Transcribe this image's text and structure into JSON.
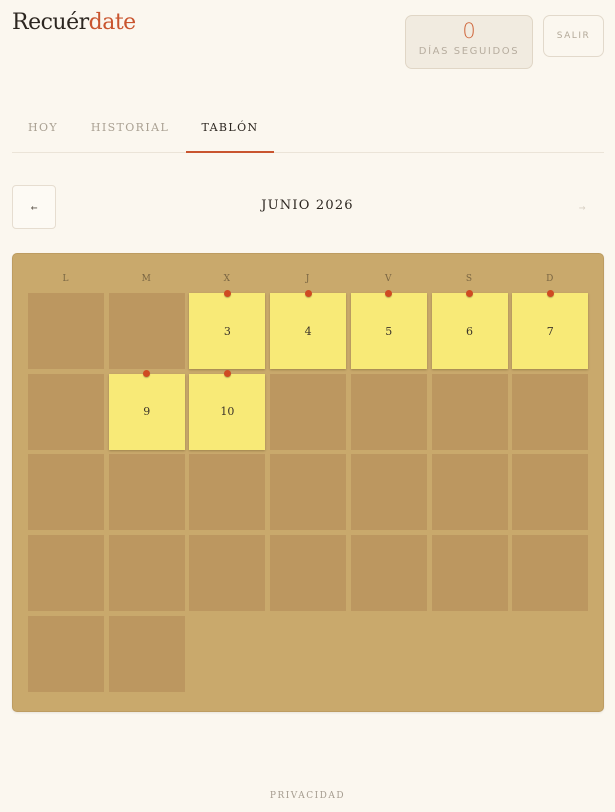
{
  "header": {
    "logo_main": "Recuér",
    "logo_accent": "date",
    "streak_count": "0",
    "streak_label": "DÍAS SEGUIDOS",
    "logout_label": "SALIR"
  },
  "tabs": [
    {
      "label": "HOY",
      "active": false
    },
    {
      "label": "HISTORIAL",
      "active": false
    },
    {
      "label": "TABLÓN",
      "active": true
    }
  ],
  "calendar": {
    "month_label": "JUNIO 2026",
    "prev_icon": "arrow-left-icon",
    "next_icon": "arrow-right-icon",
    "weekdays": [
      "L",
      "M",
      "X",
      "J",
      "V",
      "S",
      "D"
    ],
    "weeks": [
      [
        {
          "day": "",
          "note": false
        },
        {
          "day": "",
          "note": false
        },
        {
          "day": "3",
          "note": true
        },
        {
          "day": "4",
          "note": true
        },
        {
          "day": "5",
          "note": true
        },
        {
          "day": "6",
          "note": true
        },
        {
          "day": "7",
          "note": true
        }
      ],
      [
        {
          "day": "",
          "note": false
        },
        {
          "day": "9",
          "note": true
        },
        {
          "day": "10",
          "note": true
        },
        {
          "day": "",
          "note": false
        },
        {
          "day": "",
          "note": false
        },
        {
          "day": "",
          "note": false
        },
        {
          "day": "",
          "note": false
        }
      ],
      [
        {
          "day": "",
          "note": false
        },
        {
          "day": "",
          "note": false
        },
        {
          "day": "",
          "note": false
        },
        {
          "day": "",
          "note": false
        },
        {
          "day": "",
          "note": false
        },
        {
          "day": "",
          "note": false
        },
        {
          "day": "",
          "note": false
        }
      ],
      [
        {
          "day": "",
          "note": false
        },
        {
          "day": "",
          "note": false
        },
        {
          "day": "",
          "note": false
        },
        {
          "day": "",
          "note": false
        },
        {
          "day": "",
          "note": false
        },
        {
          "day": "",
          "note": false
        },
        {
          "day": "",
          "note": false
        }
      ],
      [
        {
          "day": "",
          "note": false
        },
        {
          "day": "",
          "note": false
        }
      ]
    ]
  },
  "footer": {
    "privacy_label": "PRIVACIDAD"
  },
  "colors": {
    "accent": "#c9552f",
    "board": "#c9a96c",
    "empty_cell": "#bc9760",
    "sticky_note": "#f8ea77",
    "pin": "#cf4b23"
  }
}
